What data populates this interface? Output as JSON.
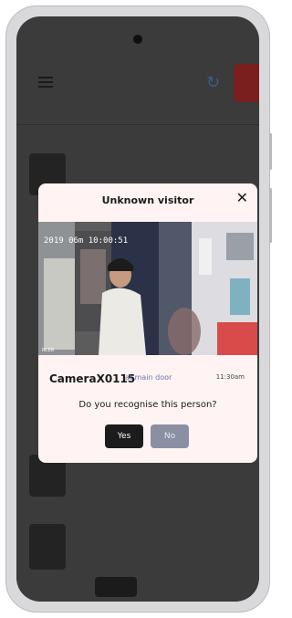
{
  "modal": {
    "title": "Unknown visitor",
    "camera_timestamp_overlay": "2019 06m 10:00:51",
    "camera_watermark": "RCER",
    "camera_name": "CameraX0115",
    "camera_location": "at main door",
    "time": "11:30am",
    "question": "Do you recognise this person?",
    "yes_label": "Yes",
    "no_label": "No"
  },
  "icons": {
    "menu": "menu-icon",
    "sync": "sync-icon",
    "close": "close-icon"
  },
  "colors": {
    "modal_background": "#fff3f3",
    "yes_button": "#1c1c1c",
    "no_button": "#8b8fa4",
    "location_text": "#6b79a8",
    "overlay": "#3b3b3b"
  }
}
